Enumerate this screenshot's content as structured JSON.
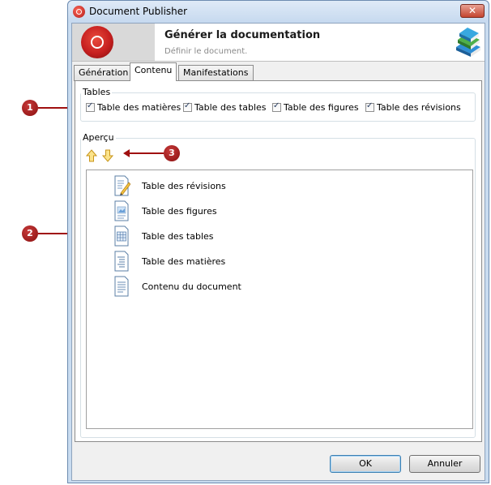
{
  "window": {
    "title": "Document Publisher",
    "close_label": "✕"
  },
  "banner": {
    "title": "Générer la documentation",
    "subtitle": "Définir le document."
  },
  "tabs": [
    {
      "label": "Génération"
    },
    {
      "label": "Contenu"
    },
    {
      "label": "Manifestations"
    }
  ],
  "tables_group": {
    "label": "Tables",
    "checkboxes": [
      {
        "label": "Table des matières",
        "checked": true
      },
      {
        "label": "Table des tables",
        "checked": true
      },
      {
        "label": "Table des figures",
        "checked": true
      },
      {
        "label": "Table des révisions",
        "checked": true
      }
    ]
  },
  "preview_group": {
    "label": "Aperçu",
    "move_up_icon": "arrow-up-icon",
    "move_down_icon": "arrow-down-icon",
    "items": [
      {
        "label": "Table des révisions",
        "icon": "document-edit-icon"
      },
      {
        "label": "Table des figures",
        "icon": "document-image-icon"
      },
      {
        "label": "Table des tables",
        "icon": "document-table-icon"
      },
      {
        "label": "Table des matières",
        "icon": "document-toc-icon"
      },
      {
        "label": "Contenu du document",
        "icon": "document-text-icon"
      }
    ]
  },
  "buttons": {
    "ok": "OK",
    "cancel": "Annuler"
  },
  "callouts": {
    "one": "1",
    "two": "2",
    "three": "3"
  },
  "colors": {
    "callout": "#a01010",
    "accent": "#3c7fb1"
  }
}
